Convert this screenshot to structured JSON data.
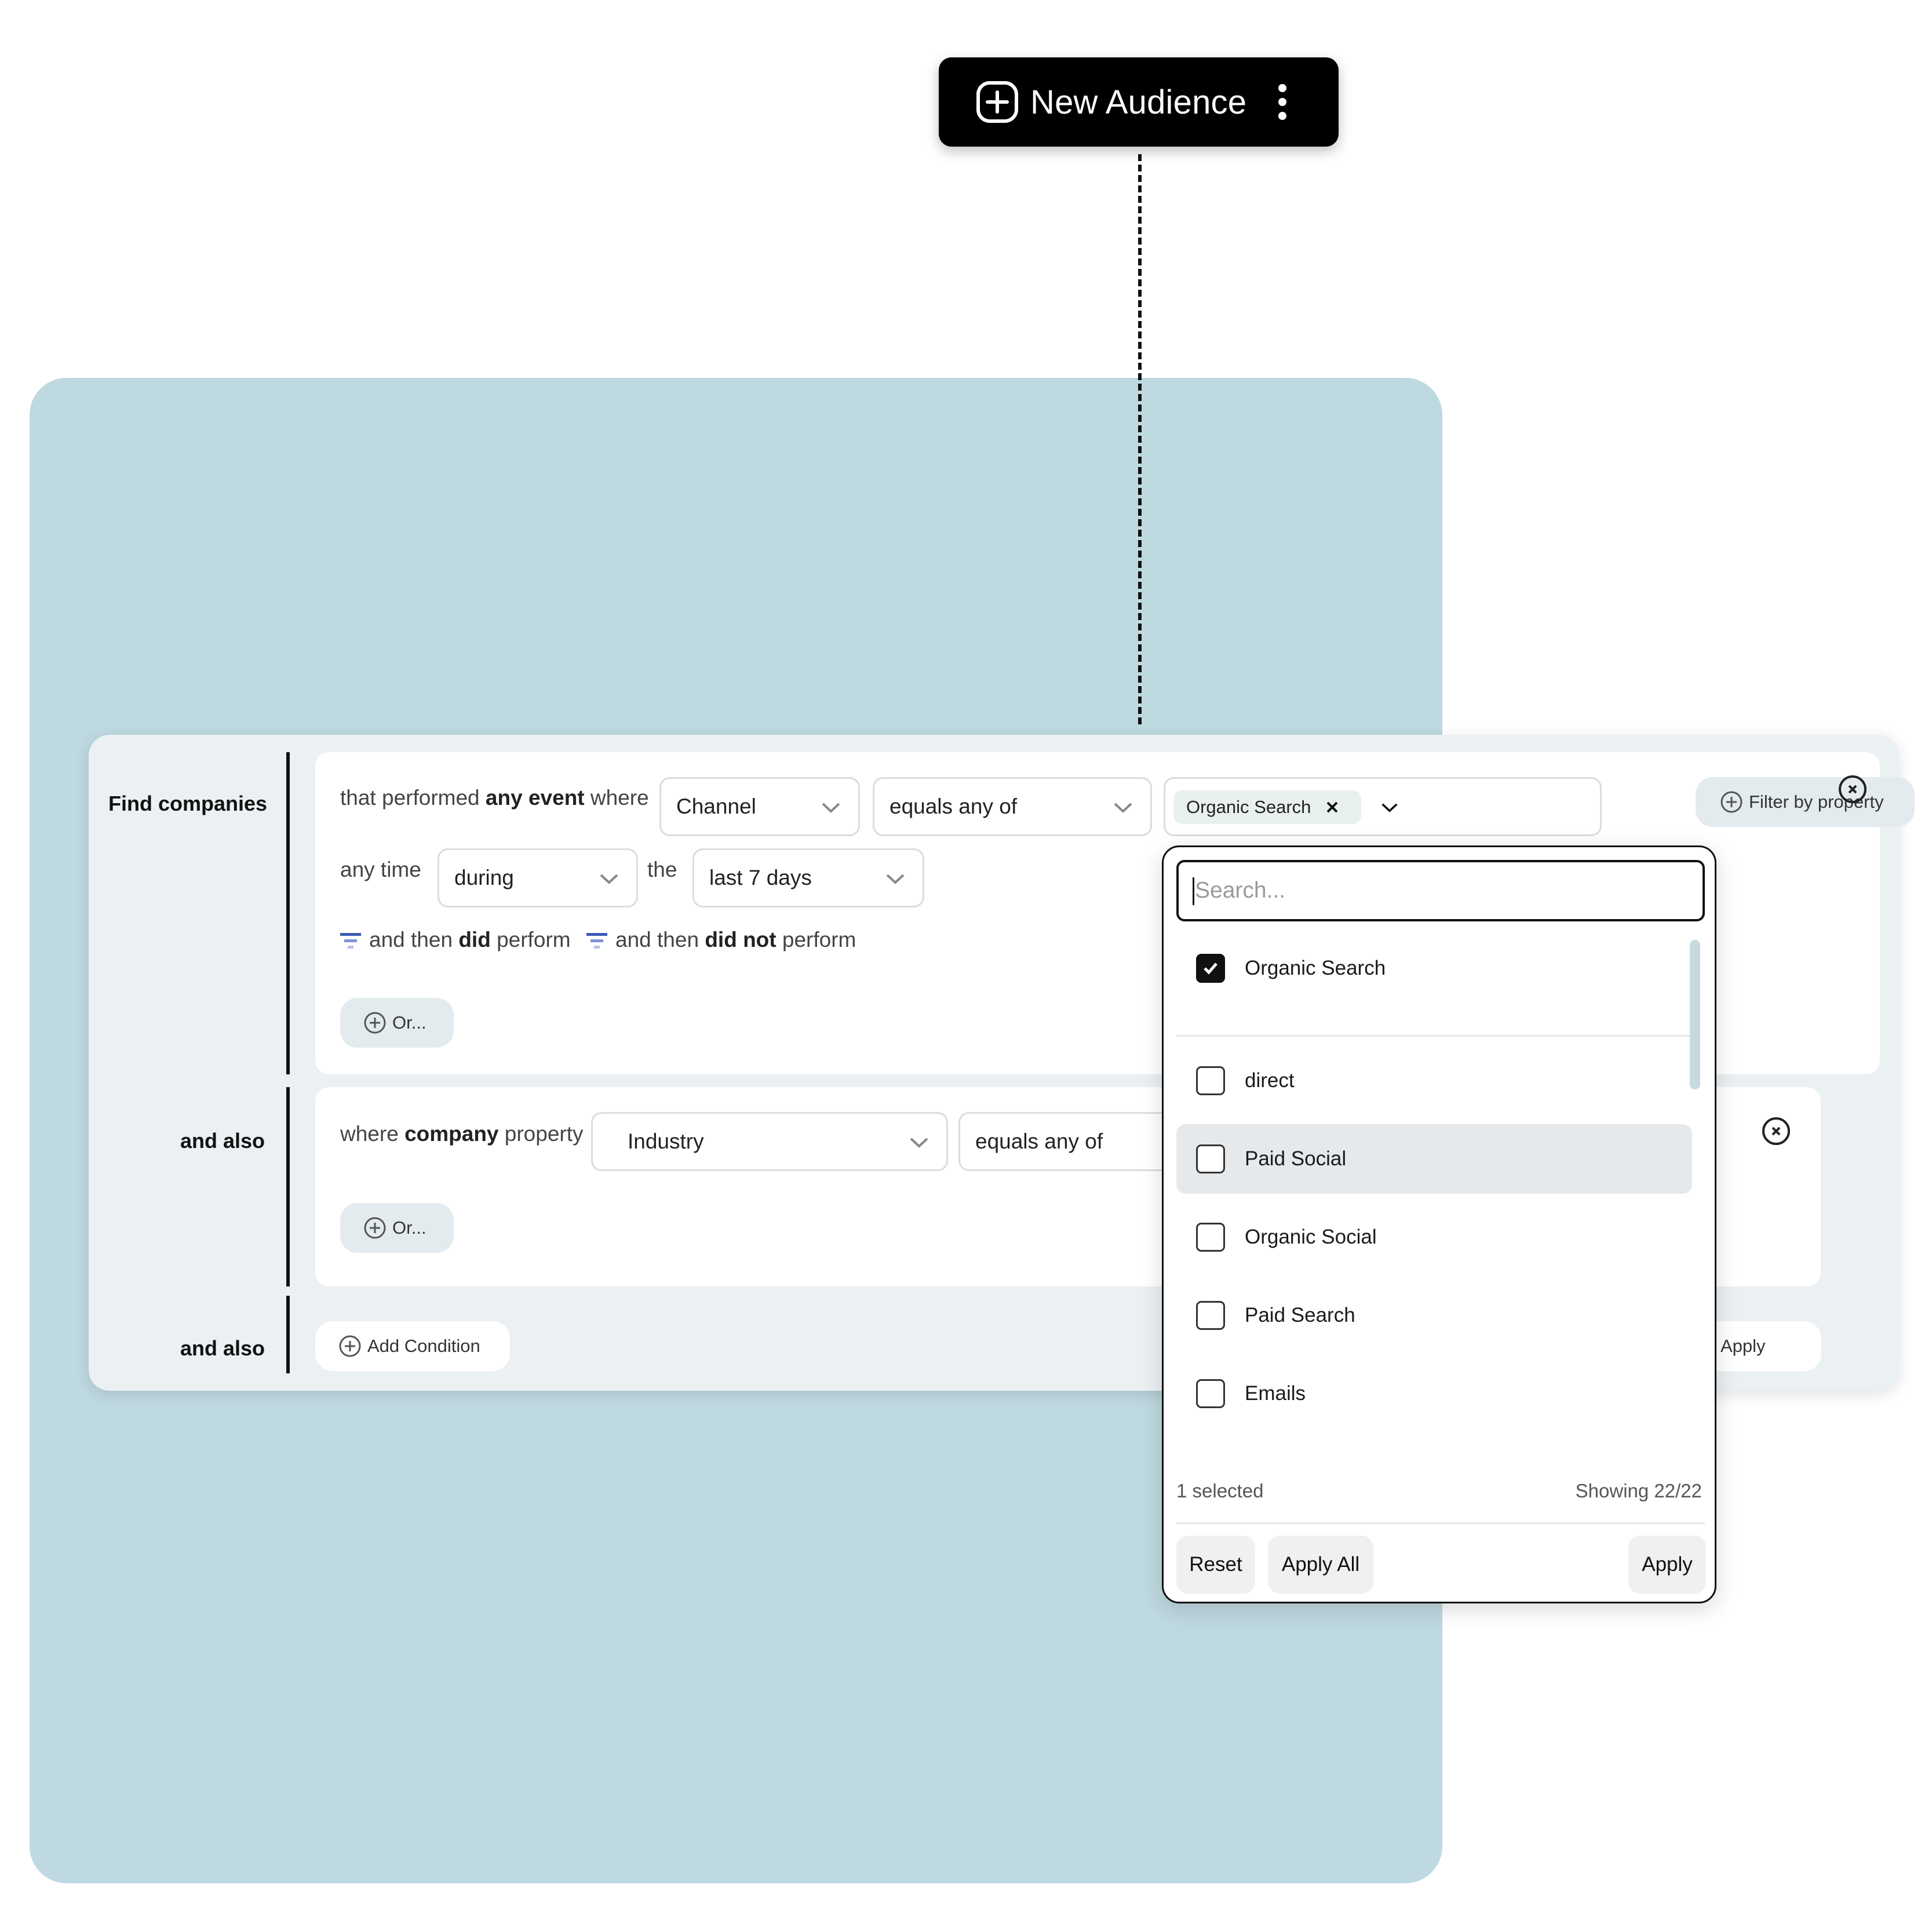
{
  "top_button": {
    "label": "New Audience",
    "icon": "plus-circle-icon",
    "menu_icon": "kebab-icon"
  },
  "builder": {
    "find": {
      "label": "Find companies",
      "sentence_prefix": "that performed",
      "sentence_bold": "any event",
      "sentence_suffix": "where",
      "property_select": "Channel",
      "operator_select": "equals any of",
      "selected_tag": "Organic Search",
      "filter_button": "Filter by property",
      "time_prefix": "any time",
      "time_select": "during",
      "time_the": "the",
      "range_select": "last 7 days",
      "then_did": {
        "pre": "and then",
        "bold": "did",
        "post": "perform"
      },
      "then_did_not": {
        "pre": "and then",
        "bold": "did not",
        "post": "perform"
      },
      "or_button": "Or..."
    },
    "also1": {
      "label": "and also",
      "prefix": "where",
      "bold": "company",
      "suffix": "property",
      "property_select": "Industry",
      "operator_select": "equals any of",
      "or_button": "Or..."
    },
    "also2": {
      "label": "and also",
      "add_condition": "Add Condition",
      "apply_partial": "Apply"
    }
  },
  "dropdown": {
    "search_placeholder": "Search...",
    "options": [
      {
        "label": "Organic Search",
        "checked": true
      },
      {
        "label": "direct",
        "checked": false
      },
      {
        "label": "Paid Social",
        "checked": false
      },
      {
        "label": "Organic Social",
        "checked": false
      },
      {
        "label": "Paid Search",
        "checked": false
      },
      {
        "label": "Emails",
        "checked": false
      }
    ],
    "selected_count": "1 selected",
    "showing": "Showing 22/22",
    "reset": "Reset",
    "apply_all": "Apply All",
    "apply": "Apply"
  },
  "colors": {
    "background_card": "#bfd9e1",
    "panel": "#ebf0f3",
    "accent_dark": "#111111"
  }
}
